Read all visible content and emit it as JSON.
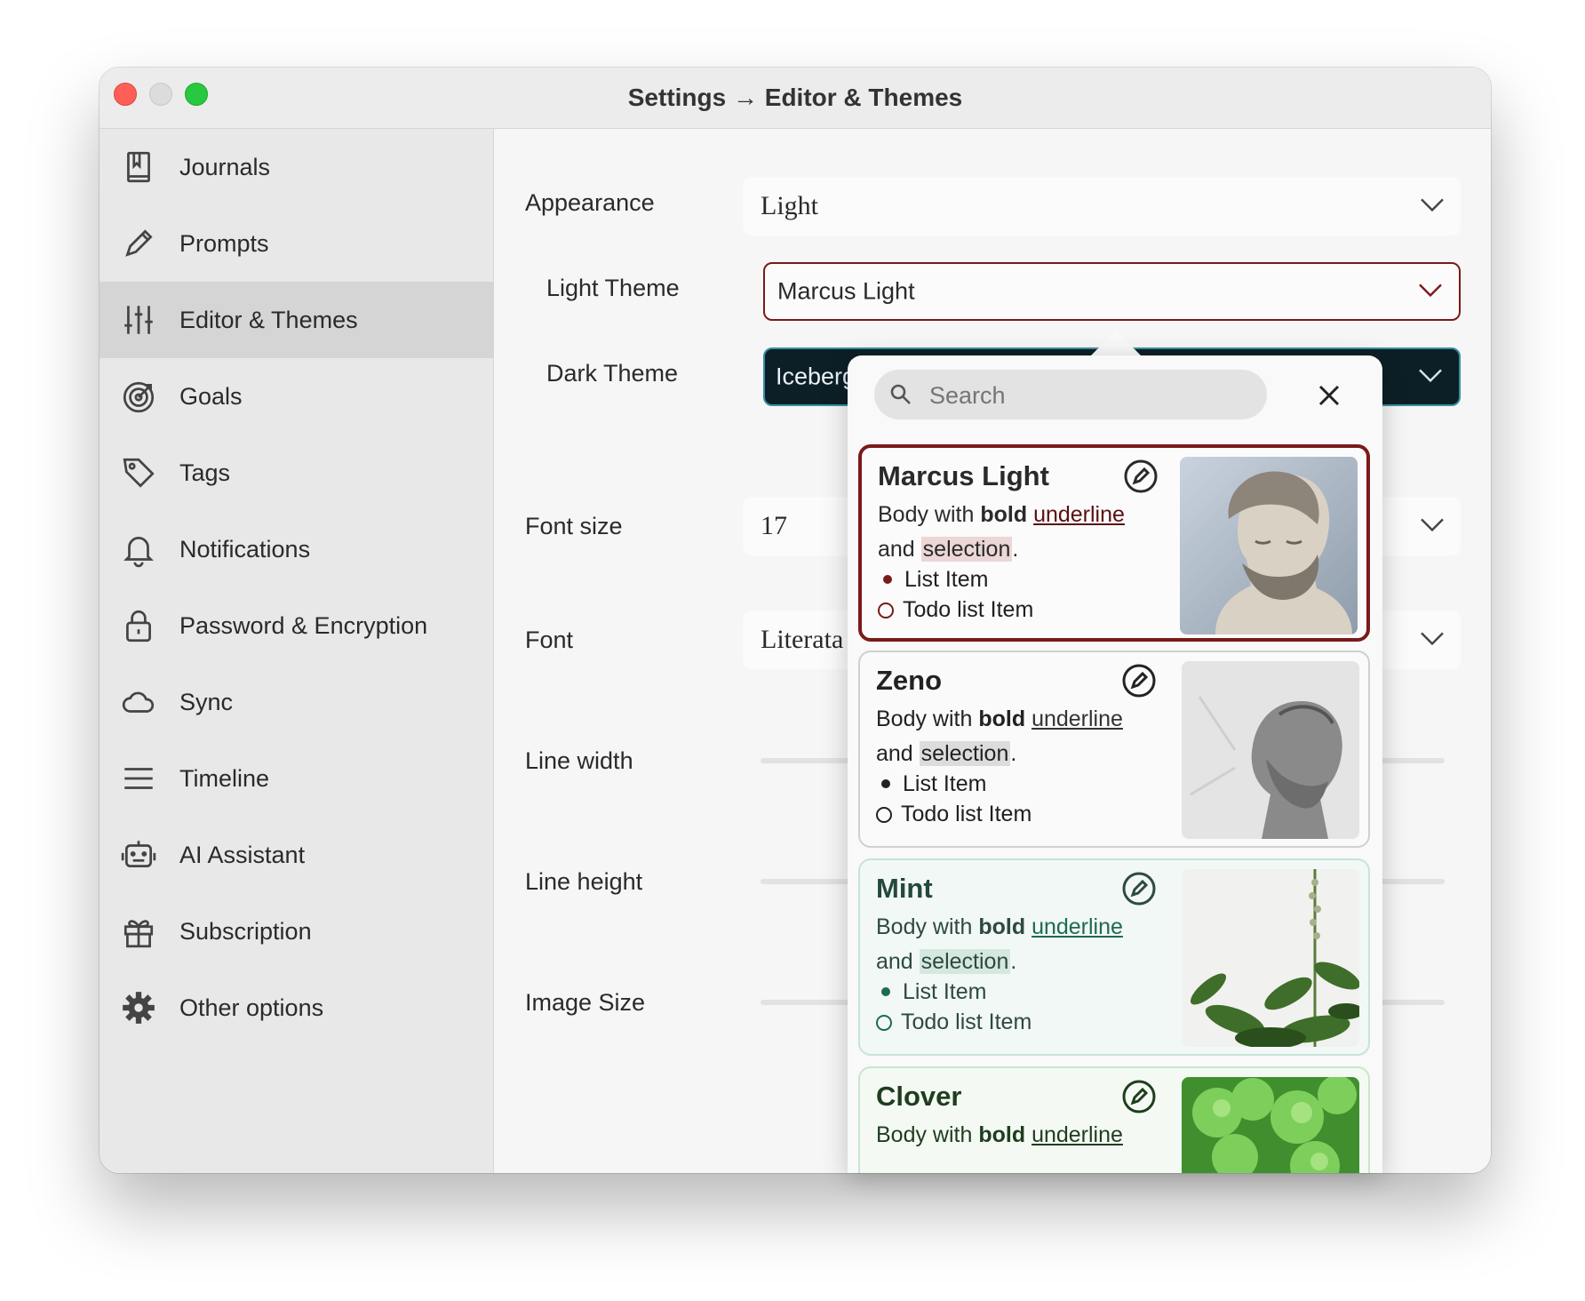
{
  "window": {
    "title": "Settings → Editor & Themes"
  },
  "sidebar": {
    "items": [
      {
        "label": "Journals",
        "icon": "journal-icon"
      },
      {
        "label": "Prompts",
        "icon": "pencil-icon"
      },
      {
        "label": "Editor & Themes",
        "icon": "sliders-icon",
        "active": true
      },
      {
        "label": "Goals",
        "icon": "target-icon"
      },
      {
        "label": "Tags",
        "icon": "tag-icon"
      },
      {
        "label": "Notifications",
        "icon": "bell-icon"
      },
      {
        "label": "Password & Encryption",
        "icon": "lock-icon"
      },
      {
        "label": "Sync",
        "icon": "cloud-icon"
      },
      {
        "label": "Timeline",
        "icon": "menu-lines-icon"
      },
      {
        "label": "AI Assistant",
        "icon": "robot-icon"
      },
      {
        "label": "Subscription",
        "icon": "gift-icon"
      },
      {
        "label": "Other options",
        "icon": "gear-icon"
      }
    ]
  },
  "settings": {
    "appearance": {
      "label": "Appearance",
      "value": "Light"
    },
    "light_theme": {
      "label": "Light Theme",
      "value": "Marcus Light"
    },
    "dark_theme": {
      "label": "Dark Theme",
      "value": "Iceberg"
    },
    "font_size": {
      "label": "Font size",
      "value": "17"
    },
    "font": {
      "label": "Font",
      "value": "Literata"
    },
    "line_width": {
      "label": "Line width"
    },
    "line_height": {
      "label": "Line height"
    },
    "image_size": {
      "label": "Image Size"
    }
  },
  "theme_picker": {
    "search_placeholder": "Search",
    "preview": {
      "body_prefix": "Body with ",
      "bold": "bold",
      "underline": "underline",
      "and": "and ",
      "selection": "selection",
      "period": ".",
      "list_item": "List Item",
      "todo_item": "Todo list Item"
    },
    "themes": [
      {
        "name": "Marcus Light",
        "selected": true,
        "accent": "#7a1a1a",
        "selection_bg": "#ecd6d6"
      },
      {
        "name": "Zeno",
        "selected": false,
        "accent": "#222222",
        "selection_bg": "#dcdcdc"
      },
      {
        "name": "Mint",
        "selected": false,
        "accent": "#1e6b4f",
        "selection_bg": "#d5e8df"
      },
      {
        "name": "Clover",
        "selected": false,
        "accent": "#1f3d1f",
        "selection_bg": "#d6ead6"
      }
    ]
  },
  "colors": {
    "selected_border": "#7a1a1a",
    "dark_theme_bg": "#0d1f26",
    "dark_theme_border": "#3a8ea0"
  }
}
